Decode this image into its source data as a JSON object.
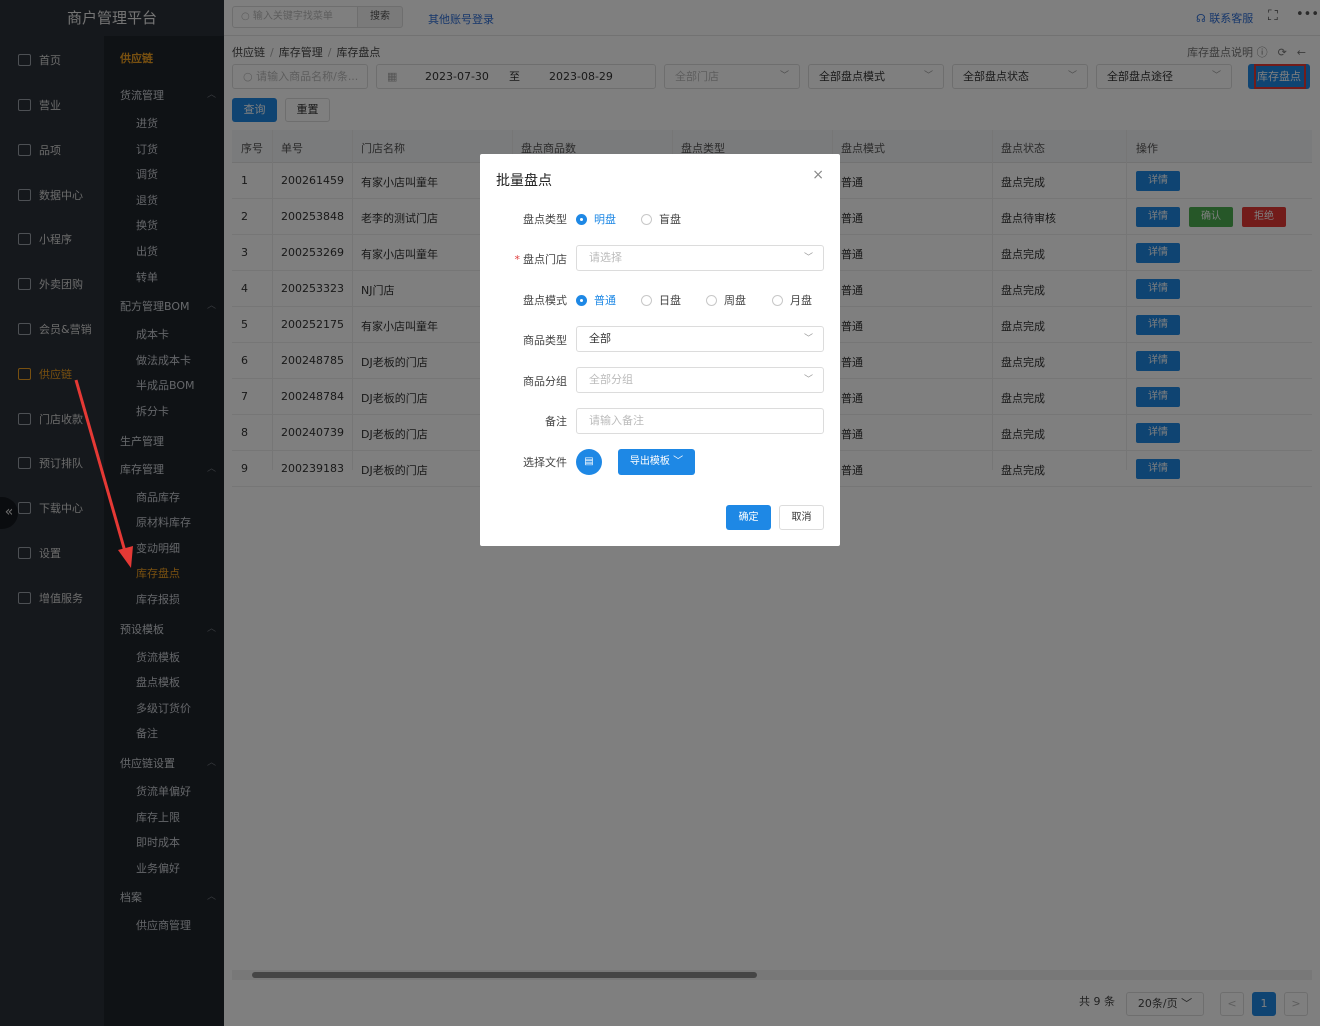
{
  "app": {
    "title": "商户管理平台"
  },
  "topbar": {
    "search_placeholder": "输入关键字找菜单",
    "search_button": "搜索",
    "other_login": "其他账号登录",
    "contact_service": "联系客服"
  },
  "nav": {
    "primary": [
      {
        "label": "首页"
      },
      {
        "label": "营业"
      },
      {
        "label": "品项"
      },
      {
        "label": "数据中心"
      },
      {
        "label": "小程序"
      },
      {
        "label": "外卖团购"
      },
      {
        "label": "会员&营销"
      },
      {
        "label": "供应链",
        "active": true
      },
      {
        "label": "门店收款"
      },
      {
        "label": "预订排队"
      },
      {
        "label": "下载中心"
      },
      {
        "label": "设置"
      },
      {
        "label": "增值服务"
      }
    ],
    "secondary_title": "供应链",
    "groups": [
      {
        "label": "货流管理",
        "items": [
          "进货",
          "订货",
          "调货",
          "退货",
          "换货",
          "出货",
          "转单"
        ]
      },
      {
        "label": "配方管理BOM",
        "items": [
          "成本卡",
          "做法成本卡",
          "半成品BOM",
          "拆分卡"
        ]
      },
      {
        "label": "生产管理",
        "items": []
      },
      {
        "label": "库存管理",
        "items": [
          "商品库存",
          "原材料库存",
          "变动明细",
          "库存盘点",
          "库存报损"
        ]
      },
      {
        "label": "预设模板",
        "items": [
          "货流模板",
          "盘点模板",
          "多级订货价",
          "备注"
        ]
      },
      {
        "label": "供应链设置",
        "items": [
          "货流单偏好",
          "库存上限",
          "即时成本",
          "业务偏好"
        ]
      },
      {
        "label": "档案",
        "items": [
          "供应商管理"
        ]
      }
    ],
    "active_item": "库存盘点"
  },
  "breadcrumb": [
    "供应链",
    "库存管理",
    "库存盘点"
  ],
  "help_link": "库存盘点说明",
  "filters": {
    "search_placeholder": "请输入商品名称/条...",
    "date_start": "2023-07-30",
    "date_sep": "至",
    "date_end": "2023-08-29",
    "store": "全部门店",
    "mode": "全部盘点模式",
    "status": "全部盘点状态",
    "route": "全部盘点途径",
    "stocktake_button": "库存盘点",
    "query_button": "查询",
    "reset_button": "重置"
  },
  "table": {
    "columns": [
      "序号",
      "单号",
      "门店名称",
      "盘点商品数",
      "盘点类型",
      "盘点模式",
      "盘点状态",
      "操作"
    ],
    "rows": [
      {
        "no": "1",
        "id": "200261459",
        "store": "有家小店叫童年",
        "mode": "普通",
        "status": "盘点完成",
        "actions": [
          "详情"
        ]
      },
      {
        "no": "2",
        "id": "200253848",
        "store": "老李的测试门店",
        "mode": "普通",
        "status": "盘点待审核",
        "actions": [
          "详情",
          "确认",
          "拒绝"
        ]
      },
      {
        "no": "3",
        "id": "200253269",
        "store": "有家小店叫童年",
        "mode": "普通",
        "status": "盘点完成",
        "actions": [
          "详情"
        ]
      },
      {
        "no": "4",
        "id": "200253323",
        "store": "NJ门店",
        "mode": "普通",
        "status": "盘点完成",
        "actions": [
          "详情"
        ]
      },
      {
        "no": "5",
        "id": "200252175",
        "store": "有家小店叫童年",
        "mode": "普通",
        "status": "盘点完成",
        "actions": [
          "详情"
        ]
      },
      {
        "no": "6",
        "id": "200248785",
        "store": "DJ老板的门店",
        "mode": "普通",
        "status": "盘点完成",
        "actions": [
          "详情"
        ]
      },
      {
        "no": "7",
        "id": "200248784",
        "store": "DJ老板的门店",
        "mode": "普通",
        "status": "盘点完成",
        "actions": [
          "详情"
        ]
      },
      {
        "no": "8",
        "id": "200240739",
        "store": "DJ老板的门店",
        "mode": "普通",
        "status": "盘点完成",
        "actions": [
          "详情"
        ]
      },
      {
        "no": "9",
        "id": "200239183",
        "store": "DJ老板的门店",
        "mode": "普通",
        "status": "盘点完成",
        "actions": [
          "详情"
        ]
      }
    ]
  },
  "pagination": {
    "total": "共 9 条",
    "page_size": "20条/页",
    "current_page": "1",
    "prev": "<",
    "next": ">"
  },
  "dialog": {
    "title": "批量盘点",
    "close": "×",
    "type_label": "盘点类型",
    "type_options": [
      "明盘",
      "盲盘"
    ],
    "store_label": "盘点门店",
    "store_placeholder": "请选择",
    "mode_label": "盘点模式",
    "mode_options": [
      "普通",
      "日盘",
      "周盘",
      "月盘"
    ],
    "goods_type_label": "商品类型",
    "goods_type_value": "全部",
    "goods_group_label": "商品分组",
    "goods_group_placeholder": "全部分组",
    "remark_label": "备注",
    "remark_placeholder": "请输入备注",
    "file_label": "选择文件",
    "export_button": "导出模板",
    "confirm_button": "确定",
    "cancel_button": "取消"
  },
  "colors": {
    "accent": "#1e88e5",
    "active_nav": "#f0a020",
    "confirm": "#4caf50",
    "reject": "#e53935",
    "highlight_box": "#e53935"
  }
}
